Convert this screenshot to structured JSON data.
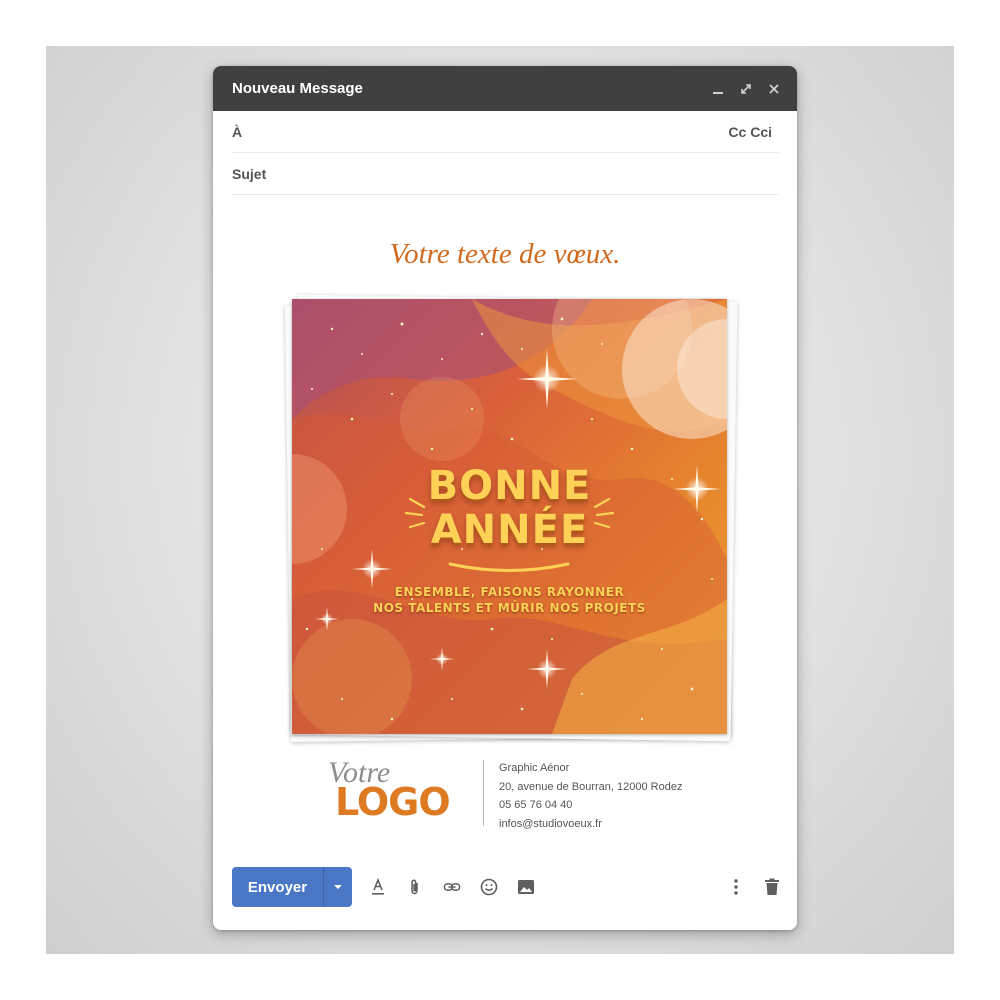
{
  "window": {
    "title": "Nouveau Message",
    "controls": [
      "minimize-icon",
      "expand-icon",
      "close-icon"
    ]
  },
  "fields": {
    "to_label": "À",
    "cc_label": "Cc Cci",
    "subject_label": "Sujet"
  },
  "body": {
    "wishes": "Votre texte de vœux.",
    "card": {
      "headline_1": "BONNE",
      "headline_2": "ANNÉE",
      "tagline_1": "ENSEMBLE, FAISONS RAYONNER",
      "tagline_2": "NOS TALENTS ET MÛRIR NOS PROJETS"
    }
  },
  "signature": {
    "logo_script": "Votre",
    "logo_word": "LOGO",
    "company": "Graphic Aénor",
    "address": "20, avenue de Bourran, 12000 Rodez",
    "phone": "05 65 76 04 40",
    "email": "infos@studiovoeux.fr"
  },
  "toolbar": {
    "send_label": "Envoyer",
    "icons": [
      "format-text-icon",
      "attachment-icon",
      "link-icon",
      "emoji-icon",
      "image-icon",
      "more-vert-icon",
      "trash-icon"
    ]
  },
  "colors": {
    "titlebar": "#404040",
    "send_button": "#4a76c6",
    "accent_orange": "#d06a1e",
    "card_gold": "#ffd257"
  }
}
